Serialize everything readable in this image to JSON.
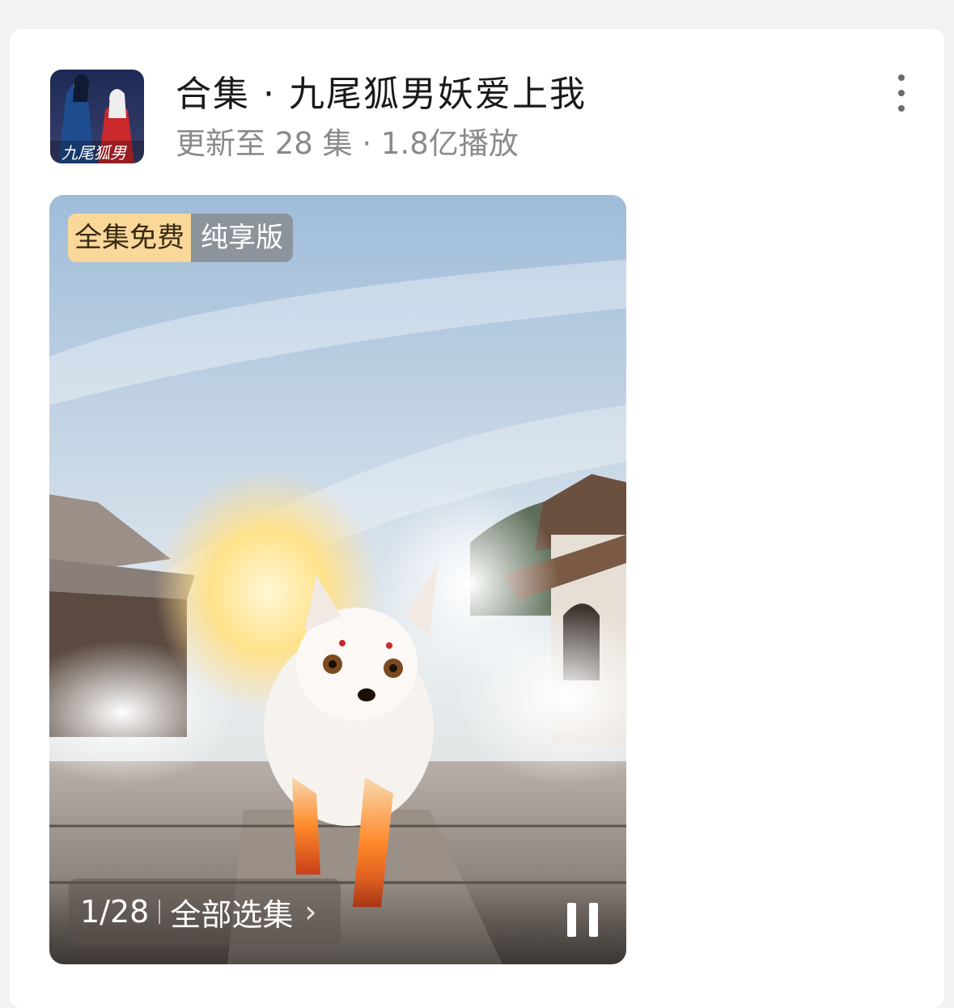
{
  "collection": {
    "title": "合集 · 九尾狐男妖爱上我",
    "subtitle": "更新至 28 集 · 1.8亿播放",
    "cover_icon": "drama-cover-thumbnail",
    "more_icon": "more-vertical-icon"
  },
  "video": {
    "badge_free": "全集免费",
    "badge_version": "纯享版",
    "episode_count": "1/28",
    "all_episodes": "全部选集",
    "chevron": "›",
    "pause_icon": "pause-icon",
    "accent": "#f9d89a"
  }
}
